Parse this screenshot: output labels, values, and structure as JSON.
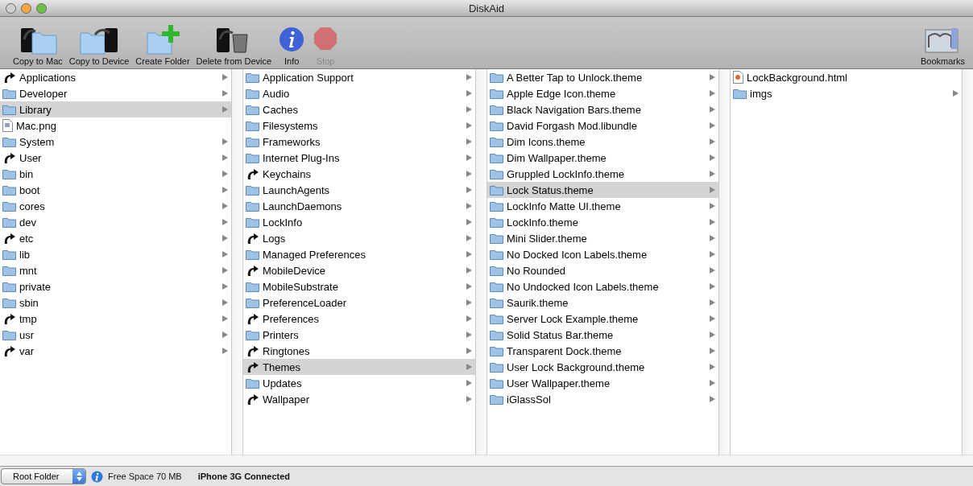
{
  "window": {
    "title": "DiskAid"
  },
  "toolbar": [
    {
      "label": "Copy to Mac",
      "kind": "copy-to-mac",
      "disabled": false
    },
    {
      "label": "Copy to Device",
      "kind": "copy-to-device",
      "disabled": false
    },
    {
      "label": "Create Folder",
      "kind": "create-folder",
      "disabled": false
    },
    {
      "label": "Delete from Device",
      "kind": "delete",
      "disabled": false
    },
    {
      "label": "Info",
      "kind": "info",
      "disabled": false
    },
    {
      "label": "Stop",
      "kind": "stop",
      "disabled": true
    }
  ],
  "bookmarks": {
    "label": "Bookmarks"
  },
  "columns": [
    {
      "items": [
        {
          "name": "Applications",
          "kind": "alias",
          "expandable": true,
          "selected": false
        },
        {
          "name": "Developer",
          "kind": "folder",
          "expandable": true,
          "selected": false
        },
        {
          "name": "Library",
          "kind": "folder",
          "expandable": true,
          "selected": true
        },
        {
          "name": "Mac.png",
          "kind": "file",
          "expandable": false,
          "selected": false
        },
        {
          "name": "System",
          "kind": "folder",
          "expandable": true,
          "selected": false
        },
        {
          "name": "User",
          "kind": "alias",
          "expandable": true,
          "selected": false
        },
        {
          "name": "bin",
          "kind": "folder",
          "expandable": true,
          "selected": false
        },
        {
          "name": "boot",
          "kind": "folder",
          "expandable": true,
          "selected": false
        },
        {
          "name": "cores",
          "kind": "folder",
          "expandable": true,
          "selected": false
        },
        {
          "name": "dev",
          "kind": "folder",
          "expandable": true,
          "selected": false
        },
        {
          "name": "etc",
          "kind": "alias",
          "expandable": true,
          "selected": false
        },
        {
          "name": "lib",
          "kind": "folder",
          "expandable": true,
          "selected": false
        },
        {
          "name": "mnt",
          "kind": "folder",
          "expandable": true,
          "selected": false
        },
        {
          "name": "private",
          "kind": "folder",
          "expandable": true,
          "selected": false
        },
        {
          "name": "sbin",
          "kind": "folder",
          "expandable": true,
          "selected": false
        },
        {
          "name": "tmp",
          "kind": "alias",
          "expandable": true,
          "selected": false
        },
        {
          "name": "usr",
          "kind": "folder",
          "expandable": true,
          "selected": false
        },
        {
          "name": "var",
          "kind": "alias",
          "expandable": true,
          "selected": false
        }
      ]
    },
    {
      "items": [
        {
          "name": "Application Support",
          "kind": "folder",
          "expandable": true,
          "selected": false
        },
        {
          "name": "Audio",
          "kind": "folder",
          "expandable": true,
          "selected": false
        },
        {
          "name": "Caches",
          "kind": "folder",
          "expandable": true,
          "selected": false
        },
        {
          "name": "Filesystems",
          "kind": "folder",
          "expandable": true,
          "selected": false
        },
        {
          "name": "Frameworks",
          "kind": "folder",
          "expandable": true,
          "selected": false
        },
        {
          "name": "Internet Plug-Ins",
          "kind": "folder",
          "expandable": true,
          "selected": false
        },
        {
          "name": "Keychains",
          "kind": "alias",
          "expandable": true,
          "selected": false
        },
        {
          "name": "LaunchAgents",
          "kind": "folder",
          "expandable": true,
          "selected": false
        },
        {
          "name": "LaunchDaemons",
          "kind": "folder",
          "expandable": true,
          "selected": false
        },
        {
          "name": "LockInfo",
          "kind": "folder",
          "expandable": true,
          "selected": false
        },
        {
          "name": "Logs",
          "kind": "alias",
          "expandable": true,
          "selected": false
        },
        {
          "name": "Managed Preferences",
          "kind": "folder",
          "expandable": true,
          "selected": false
        },
        {
          "name": "MobileDevice",
          "kind": "alias",
          "expandable": true,
          "selected": false
        },
        {
          "name": "MobileSubstrate",
          "kind": "folder",
          "expandable": true,
          "selected": false
        },
        {
          "name": "PreferenceLoader",
          "kind": "folder",
          "expandable": true,
          "selected": false
        },
        {
          "name": "Preferences",
          "kind": "alias",
          "expandable": true,
          "selected": false
        },
        {
          "name": "Printers",
          "kind": "folder",
          "expandable": true,
          "selected": false
        },
        {
          "name": "Ringtones",
          "kind": "alias",
          "expandable": true,
          "selected": false
        },
        {
          "name": "Themes",
          "kind": "alias",
          "expandable": true,
          "selected": true
        },
        {
          "name": "Updates",
          "kind": "folder",
          "expandable": true,
          "selected": false
        },
        {
          "name": "Wallpaper",
          "kind": "alias",
          "expandable": true,
          "selected": false
        }
      ]
    },
    {
      "items": [
        {
          "name": "A Better Tap to Unlock.theme",
          "kind": "folder",
          "expandable": true,
          "selected": false
        },
        {
          "name": "Apple Edge Icon.theme",
          "kind": "folder",
          "expandable": true,
          "selected": false
        },
        {
          "name": "Black Navigation Bars.theme",
          "kind": "folder",
          "expandable": true,
          "selected": false
        },
        {
          "name": "David Forgash Mod.libundle",
          "kind": "folder",
          "expandable": true,
          "selected": false
        },
        {
          "name": "Dim Icons.theme",
          "kind": "folder",
          "expandable": true,
          "selected": false
        },
        {
          "name": "Dim Wallpaper.theme",
          "kind": "folder",
          "expandable": true,
          "selected": false
        },
        {
          "name": "Gruppled LockInfo.theme",
          "kind": "folder",
          "expandable": true,
          "selected": false
        },
        {
          "name": "Lock Status.theme",
          "kind": "folder",
          "expandable": true,
          "selected": true
        },
        {
          "name": "LockInfo Matte UI.theme",
          "kind": "folder",
          "expandable": true,
          "selected": false
        },
        {
          "name": "LockInfo.theme",
          "kind": "folder",
          "expandable": true,
          "selected": false
        },
        {
          "name": "Mini Slider.theme",
          "kind": "folder",
          "expandable": true,
          "selected": false
        },
        {
          "name": "No Docked Icon Labels.theme",
          "kind": "folder",
          "expandable": true,
          "selected": false
        },
        {
          "name": "No Rounded",
          "kind": "folder",
          "expandable": true,
          "selected": false
        },
        {
          "name": "No Undocked Icon Labels.theme",
          "kind": "folder",
          "expandable": true,
          "selected": false
        },
        {
          "name": "Saurik.theme",
          "kind": "folder",
          "expandable": true,
          "selected": false
        },
        {
          "name": "Server Lock Example.theme",
          "kind": "folder",
          "expandable": true,
          "selected": false
        },
        {
          "name": "Solid Status Bar.theme",
          "kind": "folder",
          "expandable": true,
          "selected": false
        },
        {
          "name": "Transparent Dock.theme",
          "kind": "folder",
          "expandable": true,
          "selected": false
        },
        {
          "name": "User Lock Background.theme",
          "kind": "folder",
          "expandable": true,
          "selected": false
        },
        {
          "name": "User Wallpaper.theme",
          "kind": "folder",
          "expandable": true,
          "selected": false
        },
        {
          "name": "iGlassSol",
          "kind": "folder",
          "expandable": true,
          "selected": false
        }
      ]
    },
    {
      "items": [
        {
          "name": "LockBackground.html",
          "kind": "html",
          "expandable": false,
          "selected": false
        },
        {
          "name": "imgs",
          "kind": "folder",
          "expandable": true,
          "selected": false
        }
      ]
    }
  ],
  "status_bar": {
    "location": "Root Folder",
    "free_space": "Free Space 70 MB",
    "device": "iPhone 3G Connected"
  }
}
